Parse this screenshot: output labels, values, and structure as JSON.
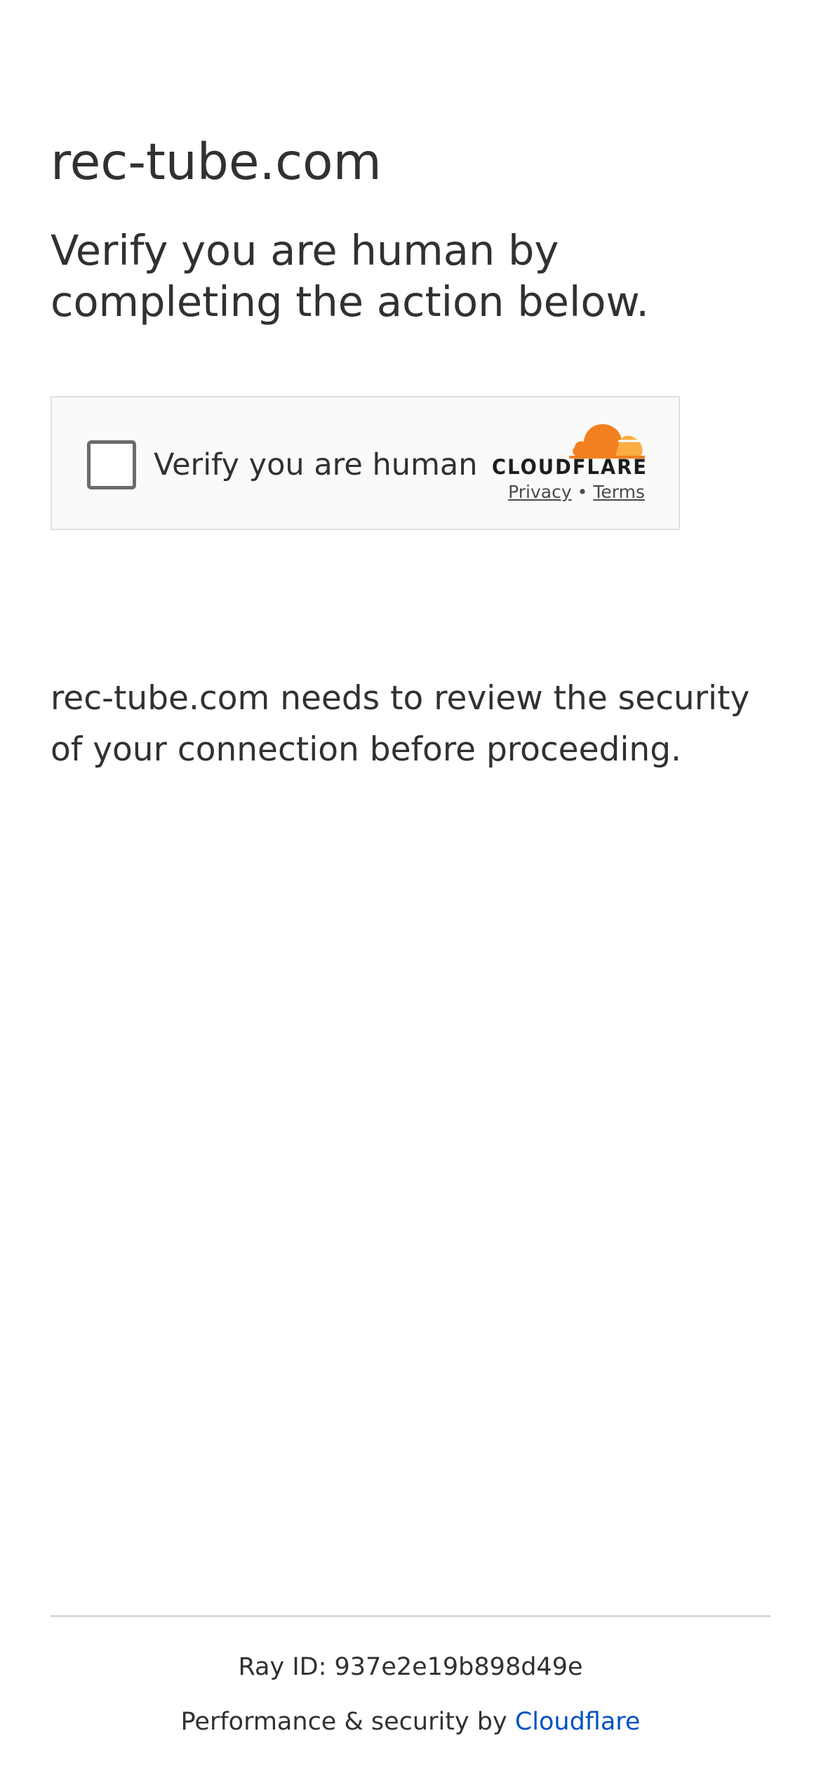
{
  "site": {
    "domain_title": "rec-tube.com"
  },
  "challenge": {
    "headline": "Verify you are human by completing the action below.",
    "widget": {
      "checkbox_label": "Verify you are human",
      "brand_name": "CLOUDFLARE",
      "privacy_link": "Privacy",
      "separator": "•",
      "terms_link": "Terms"
    },
    "notice": "rec-tube.com needs to review the security of your connection before proceeding."
  },
  "footer": {
    "ray_id": "Ray ID: 937e2e19b898d49e",
    "performance_prefix": "Performance & security by ",
    "performance_link": "Cloudflare"
  },
  "colors": {
    "text": "#313131",
    "link": "#0051c3",
    "cloud_orange": "#f38020",
    "cloud_light": "#fbad41"
  },
  "icons": {
    "logo": "cloudflare-cloud-icon",
    "checkbox": "empty-checkbox"
  }
}
